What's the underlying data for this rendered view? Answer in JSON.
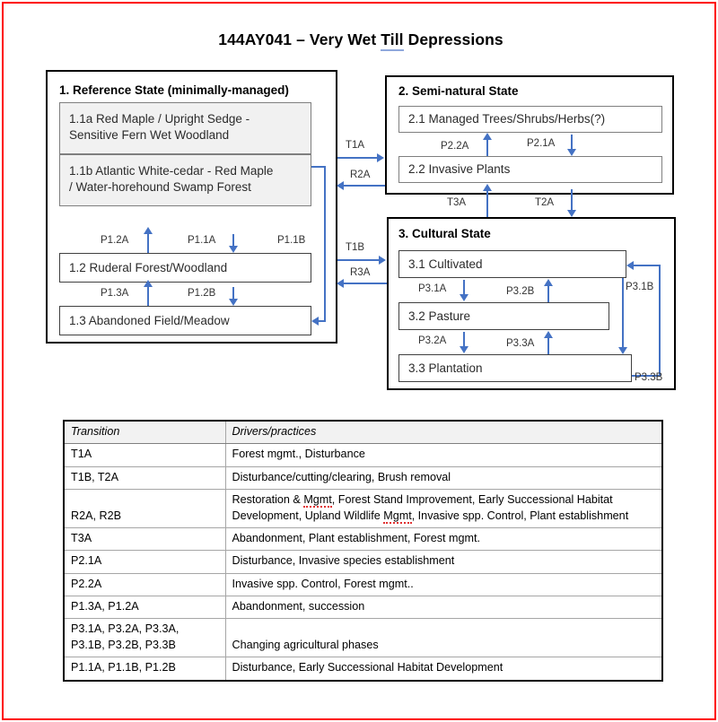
{
  "title": {
    "prefix": "144AY041 – Very Wet ",
    "spellcheck_word": "Till",
    "suffix": " Depressions",
    "underline_color": "#8fa8dc"
  },
  "colors": {
    "arrow": "#4472c4",
    "state_border": "#000000",
    "box_fill_gray": "#f1f1f1",
    "page_border": "#fe0000",
    "table_header_fill": "#f2f2f2",
    "spellcheck_red": "#e03030"
  },
  "states": [
    {
      "id": "state-1",
      "title": "1.  Reference State (minimally-managed)",
      "boxes": [
        {
          "id": "1.1a",
          "label": "1.1a Red Maple / Upright Sedge -\nSensitive Fern Wet Woodland",
          "fill": "gray"
        },
        {
          "id": "1.1b",
          "label": "1.1b Atlantic White-cedar - Red Maple\n/ Water-horehound Swamp Forest",
          "fill": "gray"
        },
        {
          "id": "1.2",
          "label": "1.2  Ruderal Forest/Woodland",
          "fill": "white"
        },
        {
          "id": "1.3",
          "label": "1.3  Abandoned Field/Meadow",
          "fill": "white"
        }
      ]
    },
    {
      "id": "state-2",
      "title": "2.  Semi-natural State",
      "boxes": [
        {
          "id": "2.1",
          "label": "2.1  Managed Trees/Shrubs/Herbs(?)",
          "fill": "white"
        },
        {
          "id": "2.2",
          "label": "2.2  Invasive Plants",
          "fill": "white"
        }
      ]
    },
    {
      "id": "state-3",
      "title": "3.  Cultural State",
      "boxes": [
        {
          "id": "3.1",
          "label": "3.1  Cultivated",
          "fill": "white"
        },
        {
          "id": "3.2",
          "label": "3.2  Pasture",
          "fill": "white"
        },
        {
          "id": "3.3",
          "label": "3.3  Plantation",
          "fill": "white"
        }
      ]
    }
  ],
  "arrow_labels": {
    "p12a": "P1.2A",
    "p11a": "P1.1A",
    "p11b": "P1.1B",
    "p13a": "P1.3A",
    "p12b": "P1.2B",
    "p22a": "P2.2A",
    "p21a": "P2.1A",
    "p31a": "P3.1A",
    "p32b": "P3.2B",
    "p31b": "P3.1B",
    "p32a": "P3.2A",
    "p33a": "P3.3A",
    "p33b": "P3.3B",
    "t1a": "T1A",
    "r2a": "R2A",
    "t1b": "T1B",
    "r3a": "R3A",
    "t3a": "T3A",
    "t2a": "T2A"
  },
  "table": {
    "headers": [
      "Transition",
      "Drivers/practices"
    ],
    "rows": [
      {
        "transition": "T1A",
        "drivers": "Forest mgmt., Disturbance"
      },
      {
        "transition": "T1B, T2A",
        "drivers": "Disturbance/cutting/clearing, Brush removal"
      },
      {
        "transition": "R2A, R2B",
        "drivers": "Restoration & Mgmt, Forest Stand Improvement, Early Successional Habitat Development, Upland Wildlife Mgmt, Invasive spp. Control, Plant establishment"
      },
      {
        "transition": "T3A",
        "drivers": "Abandonment, Plant establishment, Forest mgmt."
      },
      {
        "transition": "P2.1A",
        "drivers": "Disturbance, Invasive species establishment"
      },
      {
        "transition": "P2.2A",
        "drivers": "Invasive spp. Control, Forest mgmt.."
      },
      {
        "transition": "P1.3A, P1.2A",
        "drivers": "Abandonment, succession"
      },
      {
        "transition": "P3.1A, P3.2A, P3.3A,\nP3.1B, P3.2B, P3.3B",
        "drivers": "Changing agricultural phases"
      },
      {
        "transition": "P1.1A, P1.1B, P1.2B",
        "drivers": "Disturbance, Early Successional Habitat Development"
      }
    ]
  }
}
